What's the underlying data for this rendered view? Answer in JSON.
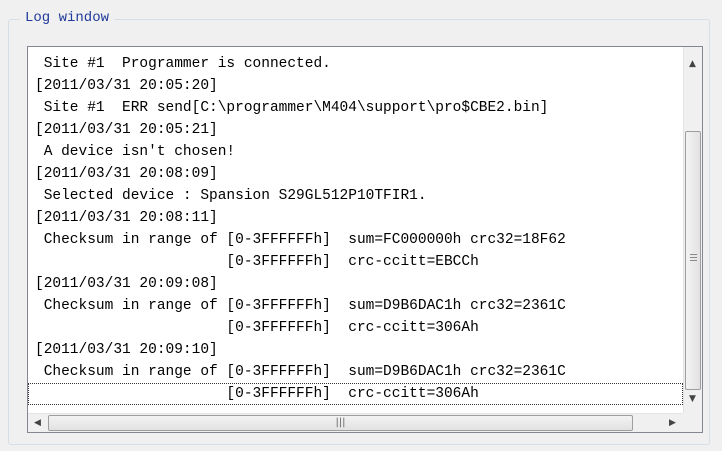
{
  "group": {
    "title": "Log window"
  },
  "log": {
    "lines": [
      " Site #1  Programmer is connected.",
      "[2011/03/31 20:05:20]",
      " Site #1  ERR send[C:\\programmer\\M404\\support\\pro$CBE2.bin]",
      "[2011/03/31 20:05:21]",
      " A device isn't chosen!",
      "[2011/03/31 20:08:09]",
      " Selected device : Spansion S29GL512P10TFIR1.",
      "[2011/03/31 20:08:11]",
      " Checksum in range of [0-3FFFFFFh]  sum=FC000000h crc32=18F62",
      "                      [0-3FFFFFFh]  crc-ccitt=EBCCh",
      "[2011/03/31 20:09:08]",
      " Checksum in range of [0-3FFFFFFh]  sum=D9B6DAC1h crc32=2361C",
      "                      [0-3FFFFFFh]  crc-ccitt=306Ah",
      "[2011/03/31 20:09:10]",
      " Checksum in range of [0-3FFFFFFh]  sum=D9B6DAC1h crc32=2361C",
      "                      [0-3FFFFFFh]  crc-ccitt=306Ah"
    ],
    "selected_index": 15
  },
  "scroll": {
    "vertical_position": 0.55,
    "horizontal_position": 0.0
  },
  "icons": {
    "up": "up-arrow-icon",
    "down": "down-arrow-icon",
    "left": "left-arrow-icon",
    "right": "right-arrow-icon",
    "grip": "grip-icon"
  }
}
